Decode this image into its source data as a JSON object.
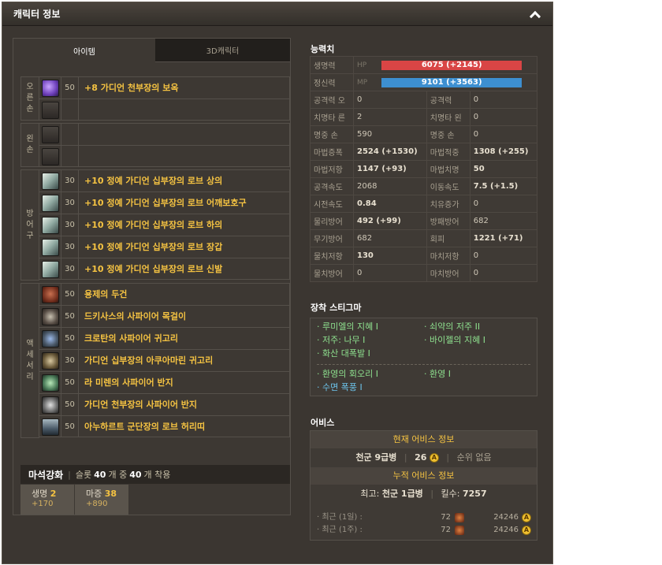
{
  "window": {
    "title": "캐릭터 정보"
  },
  "tabs": [
    {
      "label": "아이템"
    },
    {
      "label": "3D캐릭터"
    }
  ],
  "groups": {
    "right_hand": {
      "label_chars": [
        "오",
        "른",
        "손"
      ]
    },
    "left_hand": {
      "label_chars": [
        "왼",
        "손"
      ]
    },
    "armor": {
      "label_chars": [
        "방",
        "어",
        "구"
      ]
    },
    "accessory": {
      "label_chars": [
        "액",
        "세",
        "서",
        "리"
      ]
    }
  },
  "items": {
    "helmet_main": {
      "level": "50",
      "name": "+8 가디언 천부장의 보옥",
      "icon": "orb-icon"
    },
    "armor": [
      {
        "level": "30",
        "name": "+10 정예 가디언 십부장의 로브 상의",
        "icon": "robe-top-icon"
      },
      {
        "level": "30",
        "name": "+10 정예 가디언 십부장의 로브 어깨보호구",
        "icon": "shoulder-icon"
      },
      {
        "level": "30",
        "name": "+10 정예 가디언 십부장의 로브 하의",
        "icon": "pants-icon"
      },
      {
        "level": "30",
        "name": "+10 정예 가디언 십부장의 로브 장갑",
        "icon": "gloves-icon"
      },
      {
        "level": "30",
        "name": "+10 정예 가디언 십부장의 로브 신발",
        "icon": "boots-icon"
      }
    ],
    "accessories": [
      {
        "level": "50",
        "name": "용제의 두건",
        "icon": "hood-icon"
      },
      {
        "level": "50",
        "name": "드키사스의 사파이어 목걸이",
        "icon": "necklace-icon"
      },
      {
        "level": "50",
        "name": "크로탄의 사파이어 귀고리",
        "icon": "earring-icon"
      },
      {
        "level": "30",
        "name": "가디언 십부장의 아쿠아마린 귀고리",
        "icon": "earring-icon"
      },
      {
        "level": "50",
        "name": "라 미렌의 사파이어 반지",
        "icon": "ring-icon"
      },
      {
        "level": "50",
        "name": "가디언 천부장의 사파이어 반지",
        "icon": "ring-icon"
      },
      {
        "level": "50",
        "name": "아누하르트 군단장의 로브 허리띠",
        "icon": "belt-icon"
      }
    ]
  },
  "mastery": {
    "label": "마석강화",
    "text1": "슬롯",
    "slots": "40",
    "text2": "개 중",
    "equipped": "40",
    "text3": "개 착용",
    "boxes": [
      {
        "name": "생명",
        "count": "2",
        "bonus": "+170"
      },
      {
        "name": "마증",
        "count": "38",
        "bonus": "+890"
      }
    ]
  },
  "stats_section": {
    "title": "능력치",
    "hp_label": "생명력",
    "hp_tag": "HP",
    "hp_value": "6075 (+2145)",
    "mp_label": "정신력",
    "mp_tag": "MP",
    "mp_value": "9101 (+3563)",
    "right_hand_label": [
      "오",
      "른",
      "손"
    ],
    "left_hand_label": [
      "왼",
      "손"
    ],
    "rows": [
      {
        "k1": "공격력",
        "v1": "0",
        "k2": "공격력",
        "v2": "0"
      },
      {
        "k1": "치명타",
        "v1": "2",
        "k2": "치명타",
        "v2": "0"
      },
      {
        "k1": "명중",
        "v1": "590",
        "k2": "명중",
        "v2": "0"
      },
      {
        "k1": "마법증폭",
        "v1": "2524 (+1530)",
        "k2": "마법적중",
        "v2": "1308 (+255)"
      },
      {
        "k1": "마법저항",
        "v1": "1147 (+93)",
        "k2": "마법치명",
        "v2": "50"
      },
      {
        "k1": "공격속도",
        "v1": "2068",
        "k2": "이동속도",
        "v2": "7.5 (+1.5)"
      },
      {
        "k1": "시전속도",
        "v1": "0.84",
        "k2": "치유증가",
        "v2": "0"
      },
      {
        "k1": "물리방어",
        "v1": "492 (+99)",
        "k2": "방패방어",
        "v2": "682"
      },
      {
        "k1": "무기방어",
        "v1": "682",
        "k2": "회피",
        "v2": "1221 (+71)"
      },
      {
        "k1": "물치저항",
        "v1": "130",
        "k2": "마치저항",
        "v2": "0"
      },
      {
        "k1": "물치방어",
        "v1": "0",
        "k2": "마치방어",
        "v2": "0"
      }
    ]
  },
  "stigma": {
    "title": "장착 스티그마",
    "left_top": [
      "루미엘의 지혜 I",
      "저주: 나무 I",
      "화산 대폭발 I"
    ],
    "right_top": [
      "쇠약의 저주 II",
      "바이젤의 지혜 I"
    ],
    "left_bottom": [
      "환영의 회오리 I",
      "수면 폭풍 I"
    ],
    "right_bottom": [
      "환영 I"
    ]
  },
  "abyss": {
    "title": "어비스",
    "current_header": "현재 어비스 정보",
    "rank": "천군 9급병",
    "points": "26",
    "rank_status": "순위 없음",
    "cumulative_header": "누적 어비스 정보",
    "best_label": "최고:",
    "best_rank": "천군 1급병",
    "kills_label": "킬수:",
    "kills": "7257",
    "recent": [
      {
        "label": "최근 (1일) :",
        "kills": "72",
        "points": "24246"
      },
      {
        "label": "최근 (1주) :",
        "kills": "72",
        "points": "24246"
      }
    ],
    "coin_glyph": "A",
    "colors": {
      "accent": "#f5c342",
      "hp": "#d94545",
      "mp": "#3d8fd0",
      "stigma_green": "#8ee08e",
      "stigma_blue": "#6cc4ec"
    }
  }
}
